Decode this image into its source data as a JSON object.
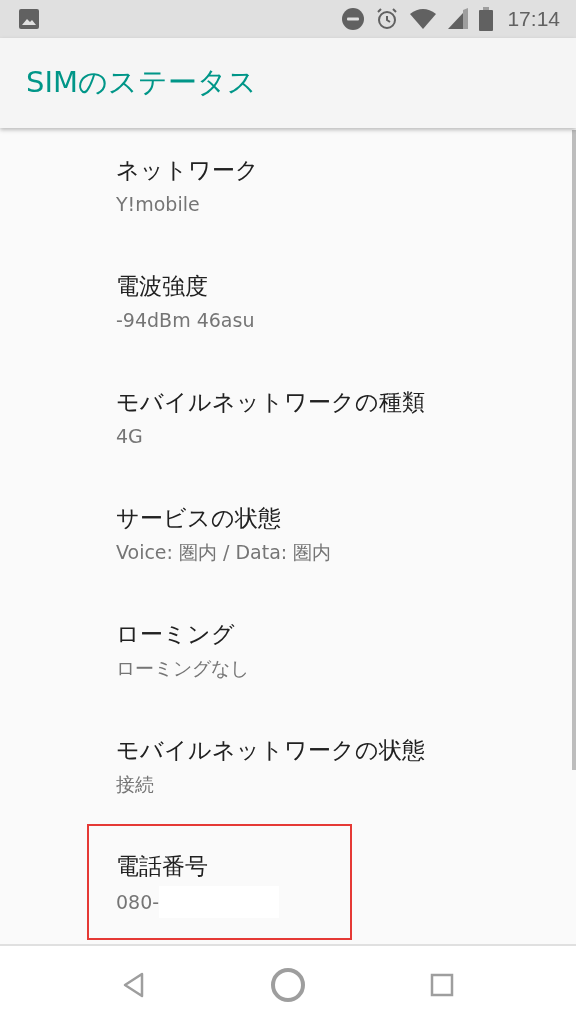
{
  "status_bar": {
    "time": "17:14"
  },
  "app_bar": {
    "title": "SIMのステータス"
  },
  "items": [
    {
      "title": "ネットワーク",
      "value": "Y!mobile",
      "highlighted": false,
      "redacted": false
    },
    {
      "title": "電波強度",
      "value": "-94dBm 46asu",
      "highlighted": false,
      "redacted": false
    },
    {
      "title": "モバイルネットワークの種類",
      "value": "4G",
      "highlighted": false,
      "redacted": false
    },
    {
      "title": "サービスの状態",
      "value": "Voice: 圏内 / Data: 圏内",
      "highlighted": false,
      "redacted": false
    },
    {
      "title": "ローミング",
      "value": "ローミングなし",
      "highlighted": false,
      "redacted": false
    },
    {
      "title": "モバイルネットワークの状態",
      "value": "接続",
      "highlighted": false,
      "redacted": false
    },
    {
      "title": "電話番号",
      "value": "080-",
      "highlighted": true,
      "redacted": true
    }
  ]
}
